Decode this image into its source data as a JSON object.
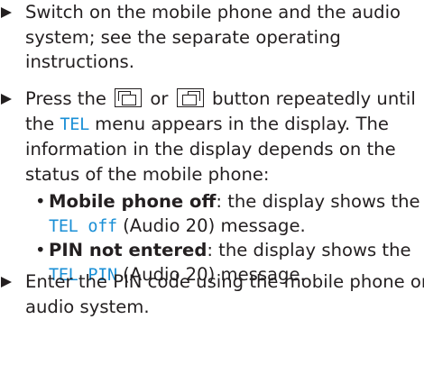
{
  "steps": [
    {
      "text": "Switch on the mobile phone and the audio system; see the separate operating instructions."
    },
    {
      "text_before_keys": "Press the",
      "key_left_icon": "page-back-icon",
      "or": "or",
      "key_right_icon": "page-forward-icon",
      "text_after_keys_1": "button repeatedly until the",
      "display_tel": "TEL",
      "text_after_keys_2": "menu appears in the display. The information in the display depends on the status of the mobile phone:"
    },
    {
      "text": "Enter the PIN code using the mobile phone or audio system."
    }
  ],
  "bullets": [
    {
      "bold": "Mobile phone off",
      "text_1": ": the display shows the",
      "display": "TEL off",
      "text_2": "(Audio 20) message."
    },
    {
      "bold": "PIN not entered",
      "text_1": ": the display shows the",
      "display": "TEL PIN",
      "text_2": "(Audio 20) message."
    }
  ],
  "colors": {
    "text": "#231f20",
    "display_text": "#1a8fd6"
  },
  "symbols": {
    "bullet": "•"
  }
}
